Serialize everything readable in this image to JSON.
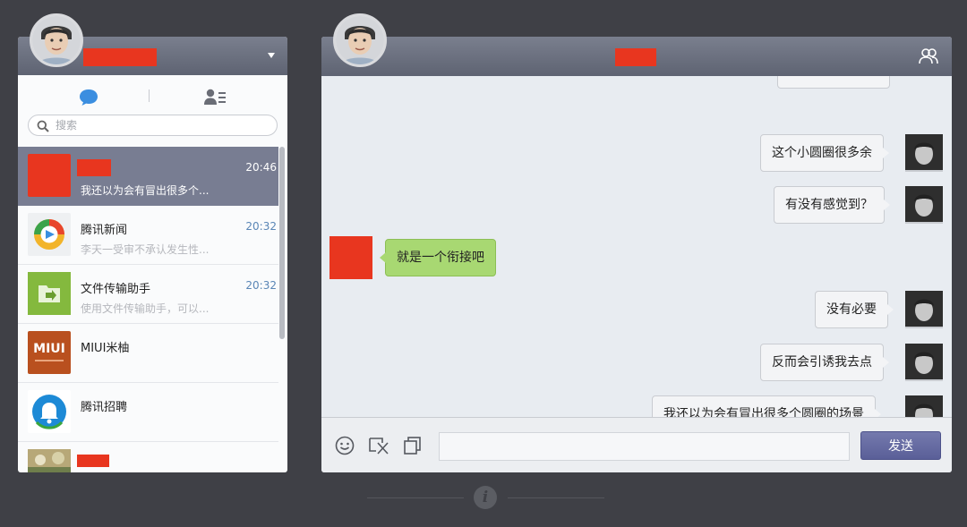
{
  "left": {
    "search_placeholder": "搜索",
    "conversations": [
      {
        "name": "",
        "time": "20:46",
        "preview": "我还以为会有冒出很多个...",
        "active": true
      },
      {
        "name": "腾讯新闻",
        "time": "20:32",
        "preview": "李天一受审不承认发生性..."
      },
      {
        "name": "文件传输助手",
        "time": "20:32",
        "preview": "使用文件传输助手，可以..."
      },
      {
        "name": "MIUI米柚",
        "time": "",
        "preview": ""
      },
      {
        "name": "腾讯招聘",
        "time": "",
        "preview": ""
      },
      {
        "name": "",
        "time": "",
        "preview": ""
      }
    ],
    "miui_logo_text": "MIUI"
  },
  "chat": {
    "messages": [
      {
        "direction": "out",
        "text": "这个小圆圈很多余"
      },
      {
        "direction": "out",
        "text": "有没有感觉到？"
      },
      {
        "direction": "in",
        "text": "就是一个衔接吧"
      },
      {
        "direction": "out",
        "text": "没有必要"
      },
      {
        "direction": "out",
        "text": "反而会引诱我去点"
      },
      {
        "direction": "out",
        "text": "我还以为会有冒出很多个圆圈的场景"
      }
    ],
    "send_label": "发送"
  },
  "info_glyph": "i",
  "colors": {
    "background": "#3f4046",
    "header": "#6a6f7e",
    "active_row": "#787d92",
    "incoming_bubble": "#a8d872",
    "redaction": "#e8361f",
    "send_button": "#6469a3",
    "time": "#5a86b6"
  },
  "icons": [
    "chat-bubble-icon",
    "contacts-icon",
    "search-icon",
    "group-icon",
    "smiley-icon",
    "screenshot-icon",
    "window-icon",
    "info-icon",
    "dropdown-arrow-icon"
  ]
}
